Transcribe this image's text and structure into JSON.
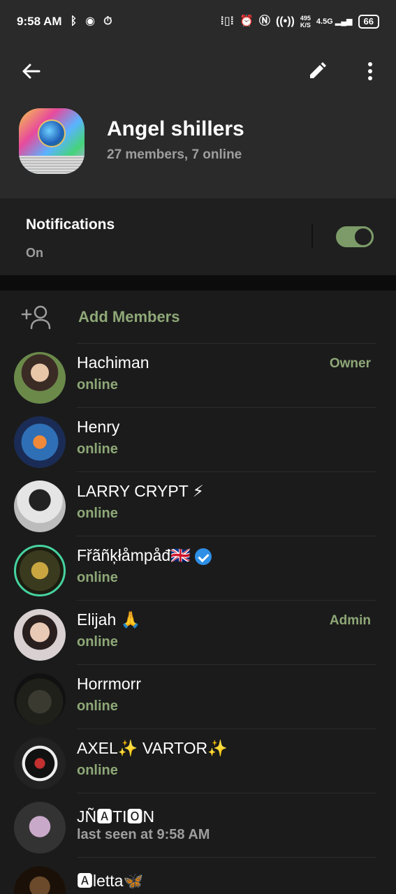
{
  "status_bar": {
    "time": "9:58 AM",
    "net_speed_value": "495",
    "net_speed_unit": "K/S",
    "network": "4.5G",
    "battery": "66"
  },
  "group": {
    "title": "Angel shillers",
    "subtitle": "27 members, 7 online"
  },
  "notifications": {
    "title": "Notifications",
    "status": "On",
    "enabled": true
  },
  "add_members_label": "Add Members",
  "members": [
    {
      "name": "Hachiman",
      "status": "online",
      "role": "Owner"
    },
    {
      "name": "Henry",
      "status": "online",
      "role": ""
    },
    {
      "name": "LARRY CRYPT ⚡",
      "status": "online",
      "role": ""
    },
    {
      "name": "Fřãñķłåmpåđ🇬🇧",
      "status": "online",
      "role": ""
    },
    {
      "name": "Elijah 🙏",
      "status": "online",
      "role": "Admin"
    },
    {
      "name": "Horrmorr",
      "status": "online",
      "role": ""
    },
    {
      "name": "AXEL✨ VARTOR✨",
      "status": "online",
      "role": ""
    },
    {
      "name": "JÑ🅰TI🅾N",
      "status": "last seen at 9:58 AM",
      "role": ""
    },
    {
      "name": "🅰letta🦋",
      "status": "",
      "role": ""
    }
  ],
  "colors": {
    "accent": "#8ea877",
    "header_bg": "#2a2a2a",
    "body_bg": "#1b1b1b"
  }
}
